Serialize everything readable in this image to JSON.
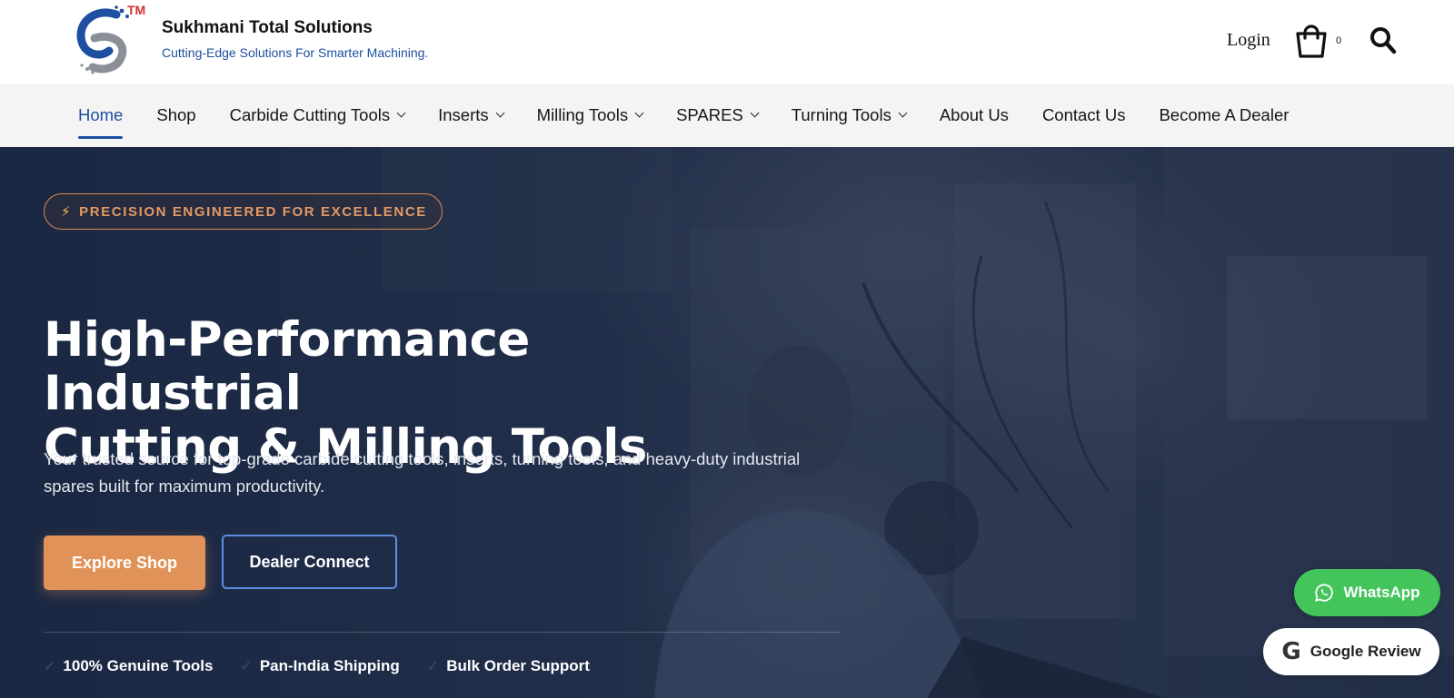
{
  "header": {
    "brand_name": "Sukhmani Total Solutions",
    "tagline": "Cutting-Edge Solutions For Smarter Machining.",
    "trademark": "TM",
    "login_label": "Login",
    "cart_count": "0",
    "icons": {
      "cart": "shopping-bag-icon",
      "search": "search-icon"
    }
  },
  "nav": {
    "items": [
      {
        "label": "Home",
        "active": true
      },
      {
        "label": "Shop"
      },
      {
        "label": "Carbide Cutting Tools",
        "dropdown": true
      },
      {
        "label": "Inserts",
        "dropdown": true
      },
      {
        "label": "Milling Tools",
        "dropdown": true
      },
      {
        "label": "SPARES",
        "dropdown": true
      },
      {
        "label": "Turning Tools",
        "dropdown": true
      },
      {
        "label": "About Us"
      },
      {
        "label": "Contact Us"
      },
      {
        "label": "Become A Dealer"
      }
    ]
  },
  "hero": {
    "badge": "PRECISION ENGINEERED FOR EXCELLENCE",
    "badge_icon": "⚡",
    "title_line1": "High-Performance Industrial",
    "title_line2": "Cutting & Milling Tools",
    "subtitle": "Your trusted source for top-grade carbide cutting tools, inserts, turning tools, and heavy-duty industrial spares built for maximum productivity.",
    "primary_button": "Explore Shop",
    "secondary_button": "Dealer Connect",
    "features": [
      "100% Genuine Tools",
      "Pan-India Shipping",
      "Bulk Order Support"
    ]
  },
  "floating": {
    "whatsapp_label": "WhatsApp",
    "google_review_label": "Google Review"
  },
  "colors": {
    "brand_blue": "#1f4fa0",
    "accent_orange": "#e09258",
    "whatsapp_green": "#43c55c",
    "hero_overlay": "#1c2a45"
  }
}
